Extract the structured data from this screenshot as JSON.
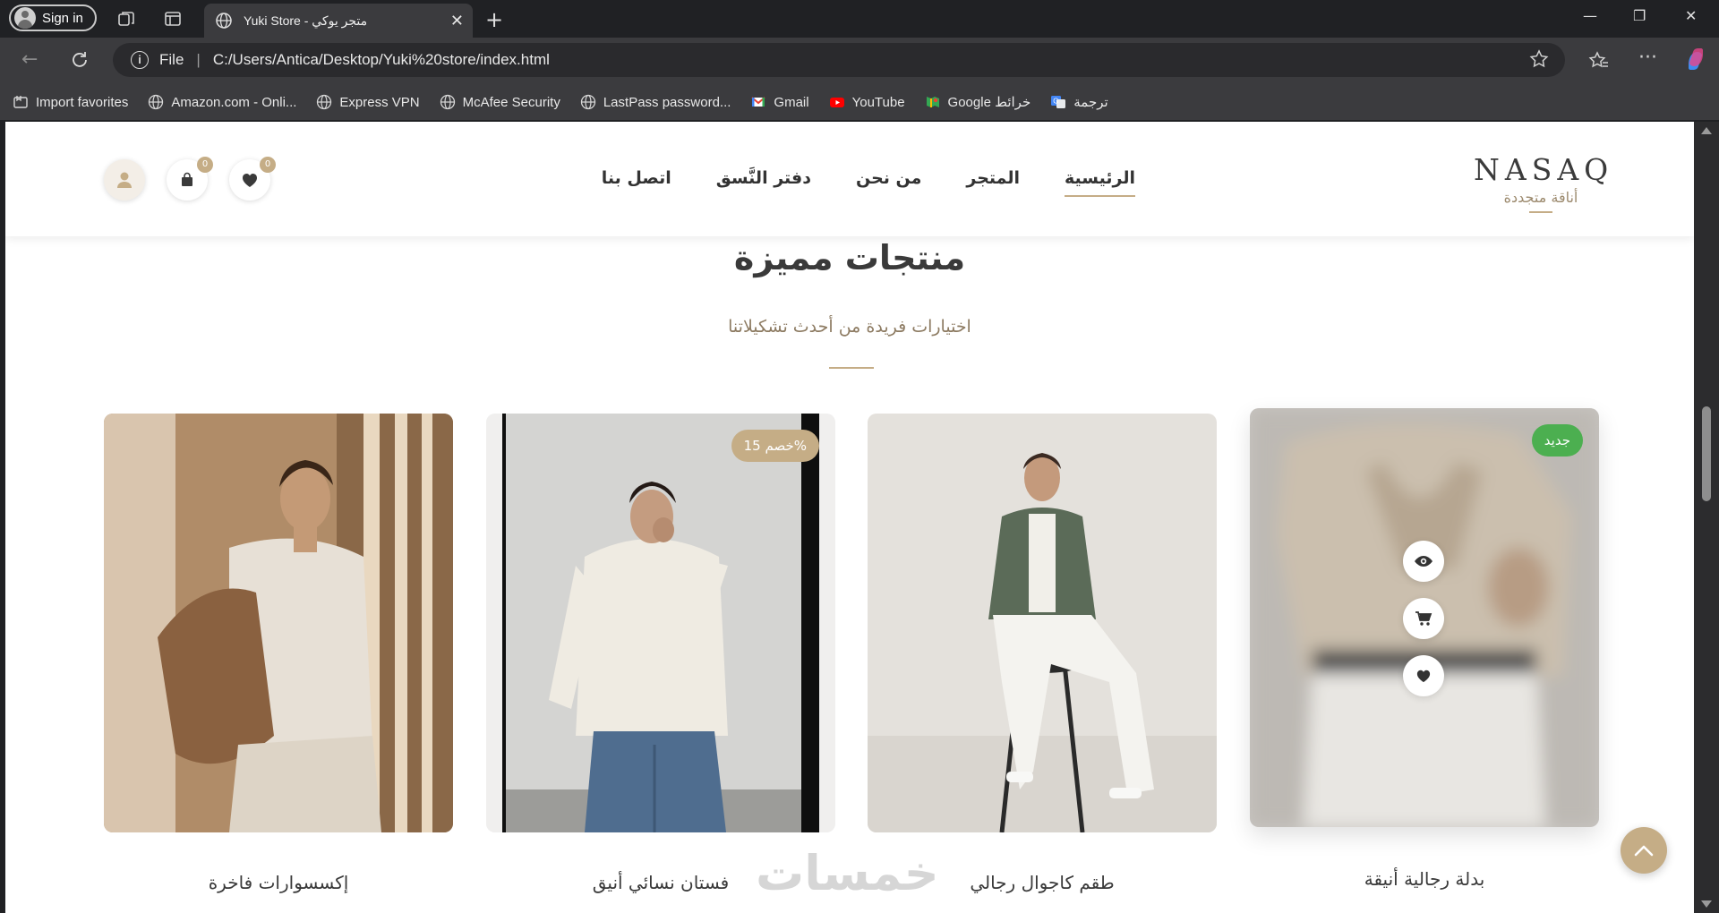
{
  "browser": {
    "signin_label": "Sign in",
    "tab_title": "Yuki Store - متجر يوكي",
    "url_scheme": "File",
    "url": "C:/Users/Antica/Desktop/Yuki%20store/index.html",
    "bookmarks": [
      {
        "label": "Import favorites",
        "icon": "import-icon"
      },
      {
        "label": "Amazon.com - Onli...",
        "icon": "globe-icon"
      },
      {
        "label": "Express VPN",
        "icon": "globe-icon"
      },
      {
        "label": "McAfee Security",
        "icon": "globe-icon"
      },
      {
        "label": "LastPass password...",
        "icon": "globe-icon"
      },
      {
        "label": "Gmail",
        "icon": "gmail-icon"
      },
      {
        "label": "YouTube",
        "icon": "youtube-icon"
      },
      {
        "label": "Google خرائط",
        "icon": "maps-icon"
      },
      {
        "label": "ترجمة",
        "icon": "translate-icon"
      }
    ]
  },
  "site": {
    "logo": "NASAQ",
    "tagline": "أناقة متجددة",
    "nav": [
      "الرئيسية",
      "المتجر",
      "من نحن",
      "دفتر النَّسق",
      "اتصل بنا"
    ],
    "wishlist_count": "0",
    "cart_count": "0",
    "accent": "#c5ad86"
  },
  "section": {
    "title": "منتجات مميزة",
    "subtitle": "اختيارات فريدة من أحدث تشكيلاتنا"
  },
  "products": [
    {
      "name": "بدلة رجالية أنيقة",
      "badge": "جديد",
      "badge_color": "#4caf50"
    },
    {
      "name": "طقم كاجوال رجالي",
      "badge": "",
      "badge_color": ""
    },
    {
      "name": "فستان نسائي أنيق",
      "badge": "خصم 15%",
      "badge_color": "#c5ad86"
    },
    {
      "name": "إكسسوارات فاخرة",
      "badge": "",
      "badge_color": ""
    }
  ],
  "watermark": "خمسات"
}
